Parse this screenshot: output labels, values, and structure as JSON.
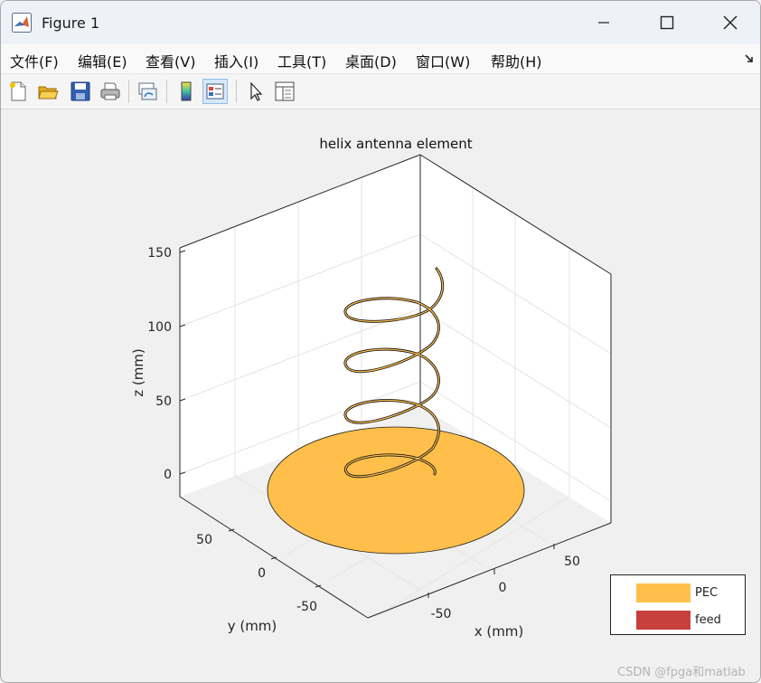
{
  "window": {
    "title": "Figure 1"
  },
  "menu": [
    "文件(F)",
    "编辑(E)",
    "查看(V)",
    "插入(I)",
    "工具(T)",
    "桌面(D)",
    "窗口(W)",
    "帮助(H)"
  ],
  "toolbar": [
    "new-figure-icon",
    "open-file-icon",
    "save-icon",
    "print-icon",
    "link-plot-icon",
    "colorbar-icon",
    "legend-icon",
    "edit-plot-arrow-icon",
    "property-inspector-icon"
  ],
  "colors": {
    "pec": "#ffbf4a",
    "feed": "#c8403c",
    "helix": "#1a1a1a"
  },
  "plot": {
    "title": "helix antenna element",
    "xlabel": "x (mm)",
    "ylabel": "y (mm)",
    "zlabel": "z (mm)",
    "zticks": [
      "150",
      "100",
      "50",
      "0"
    ],
    "yticks": [
      "50",
      "0",
      "-50"
    ],
    "xticks": [
      "50",
      "0",
      "-50"
    ]
  },
  "legend": [
    {
      "label": "PEC"
    },
    {
      "label": "feed"
    }
  ],
  "watermark": "CSDN @fpga和matlab"
}
